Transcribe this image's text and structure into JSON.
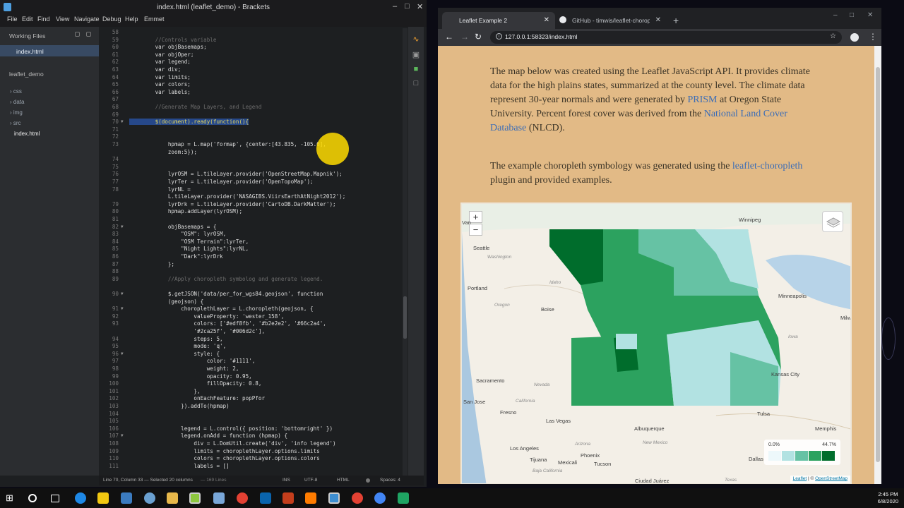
{
  "brackets": {
    "title": "index.html (leaflet_demo) - Brackets",
    "menu": [
      "File",
      "Edit",
      "Find",
      "View",
      "Navigate",
      "Debug",
      "Help",
      "Emmet"
    ],
    "sidebar": {
      "working_files_label": "Working Files",
      "working_file": "index.html",
      "project_label": "leaflet_demo",
      "tree": [
        "css",
        "data",
        "img",
        "src",
        "index.html"
      ]
    },
    "code_lines": [
      {
        "n": "58",
        "text": ""
      },
      {
        "n": "59",
        "text": "        //Controls variable",
        "style": "cm"
      },
      {
        "n": "60",
        "text": "        var objBasemaps;"
      },
      {
        "n": "61",
        "text": "        var objOper;"
      },
      {
        "n": "62",
        "text": "        var legend;"
      },
      {
        "n": "63",
        "text": "        var div;"
      },
      {
        "n": "64",
        "text": "        var limits;"
      },
      {
        "n": "65",
        "text": "        var colors;"
      },
      {
        "n": "66",
        "text": "        var labels;"
      },
      {
        "n": "67",
        "text": ""
      },
      {
        "n": "68",
        "text": "        //Generate Map Layers, and Legend",
        "style": "cm"
      },
      {
        "n": "69",
        "text": ""
      },
      {
        "n": "70",
        "text": "        $(document).ready(function(){",
        "fold": true,
        "selected": true
      },
      {
        "n": "71",
        "text": ""
      },
      {
        "n": "72",
        "text": ""
      },
      {
        "n": "73",
        "text": "            hpmap = L.map('formap', {center:[43.835, -105.6],"
      },
      {
        "n": "",
        "text": "            zoom:5});"
      },
      {
        "n": "74",
        "text": ""
      },
      {
        "n": "75",
        "text": ""
      },
      {
        "n": "76",
        "text": "            lyrOSM = L.tileLayer.provider('OpenStreetMap.Mapnik');"
      },
      {
        "n": "77",
        "text": "            lyrTer = L.tileLayer.provider('OpenTopoMap');"
      },
      {
        "n": "78",
        "text": "            lyrNL ="
      },
      {
        "n": "",
        "text": "            L.tileLayer.provider('NASAGIBS.ViirsEarthAtNight2012');"
      },
      {
        "n": "79",
        "text": "            lyrDrk = L.tileLayer.provider('CartoDB.DarkMatter');"
      },
      {
        "n": "80",
        "text": "            hpmap.addLayer(lyrOSM);"
      },
      {
        "n": "81",
        "text": ""
      },
      {
        "n": "82",
        "text": "            objBasemaps = {",
        "fold": true
      },
      {
        "n": "83",
        "text": "                \"OSM\": lyrOSM,"
      },
      {
        "n": "84",
        "text": "                \"OSM Terrain\":lyrTer,"
      },
      {
        "n": "85",
        "text": "                \"Night Lights\":lyrNL,"
      },
      {
        "n": "86",
        "text": "                \"Dark\":lyrDrk"
      },
      {
        "n": "87",
        "text": "            };"
      },
      {
        "n": "88",
        "text": ""
      },
      {
        "n": "89",
        "text": "            //Apply choropleth symbolog and generate legend.",
        "style": "cm"
      },
      {
        "n": "",
        "text": ""
      },
      {
        "n": "90",
        "text": "            $.getJSON('data/per_for_wgs84.geojson', function",
        "fold": true
      },
      {
        "n": "",
        "text": "            (geojson) {"
      },
      {
        "n": "91",
        "text": "                choroplethLayer = L.choropleth(geojson, {",
        "fold": true
      },
      {
        "n": "92",
        "text": "                    valueProperty: 'wester_158',"
      },
      {
        "n": "93",
        "text": "                    colors: ['#edf8fb', '#b2e2e2', '#66c2a4',"
      },
      {
        "n": "",
        "text": "                    '#2ca25f', '#006d2c'],"
      },
      {
        "n": "94",
        "text": "                    steps: 5,"
      },
      {
        "n": "95",
        "text": "                    mode: 'q',"
      },
      {
        "n": "96",
        "text": "                    style: {",
        "fold": true
      },
      {
        "n": "97",
        "text": "                        color: '#1111',"
      },
      {
        "n": "98",
        "text": "                        weight: 2,"
      },
      {
        "n": "99",
        "text": "                        opacity: 0.95,"
      },
      {
        "n": "100",
        "text": "                        fillOpacity: 0.8,"
      },
      {
        "n": "101",
        "text": "                    },"
      },
      {
        "n": "102",
        "text": "                    onEachFeature: popPfor"
      },
      {
        "n": "103",
        "text": "                }).addTo(hpmap)"
      },
      {
        "n": "104",
        "text": ""
      },
      {
        "n": "105",
        "text": ""
      },
      {
        "n": "106",
        "text": "                legend = L.control({ position: 'bottomright' })"
      },
      {
        "n": "107",
        "text": "                legend.onAdd = function (hpmap) {",
        "fold": true
      },
      {
        "n": "108",
        "text": "                    div = L.DomUtil.create('div', 'info legend')"
      },
      {
        "n": "109",
        "text": "                    limits = choroplethLayer.options.limits"
      },
      {
        "n": "110",
        "text": "                    colors = choroplethLayer.options.colors"
      },
      {
        "n": "111",
        "text": "                    labels = []"
      }
    ],
    "status": {
      "position": "Line 70, Column 33 — Selected 20 columns",
      "lines": "— 169 Lines",
      "mode": "INS",
      "encoding": "UTF-8",
      "language": "HTML",
      "spaces": "Spaces: 4"
    }
  },
  "chrome": {
    "tabs": [
      {
        "label": "Leaflet Example 2",
        "active": true
      },
      {
        "label": "GitHub - timwis/leaflet-choropleth",
        "active": false
      }
    ],
    "url": "127.0.0.1:58323/index.html",
    "page": {
      "p1_a": "The map below was created using the Leaflet JavaScript API. It provides climate data for the high plains states, summarized at the county level. The climate data represent 30-year normals and were generated by ",
      "p1_link1": "PRISM",
      "p1_b": " at Oregon State University. Percent forest cover was derived from the ",
      "p1_link2": "National Land Cover Database",
      "p1_c": " (NLCD).",
      "p2_a": "The example choropleth symbology was generated using the ",
      "p2_link": "leaflet-choropleth",
      "p2_b": " plugin and provided examples."
    },
    "map": {
      "zoom_in": "+",
      "zoom_out": "−",
      "cities": [
        "Winnipeg",
        "Seattle",
        "Portland",
        "Boise",
        "Minneapolis",
        "Milw",
        "Sacramento",
        "San Jose",
        "Fresno",
        "Las Vegas",
        "Los Angeles",
        "Tijuana",
        "Mexicali",
        "Phoenix",
        "Tucson",
        "Albuquerque",
        "Tulsa",
        "Dallas",
        "Memphis",
        "Ciudad Juárez",
        "Kansas City",
        "Van"
      ],
      "states": [
        "Washington",
        "Oregon",
        "Idaho",
        "Nevada",
        "California",
        "Arizona",
        "New Mexico",
        "Iowa",
        "Texas",
        "Baja California"
      ],
      "legend": {
        "min": "0.0%",
        "max": "44.7%",
        "colors": [
          "#edf8fb",
          "#b2e2e2",
          "#66c2a4",
          "#2ca25f",
          "#006d2c"
        ]
      },
      "attribution_leaflet": "Leaflet",
      "attribution_sep": " | © ",
      "attribution_osm": "OpenStreetMap"
    }
  },
  "taskbar": {
    "time": "2:45 PM",
    "date": "6/8/2020"
  }
}
